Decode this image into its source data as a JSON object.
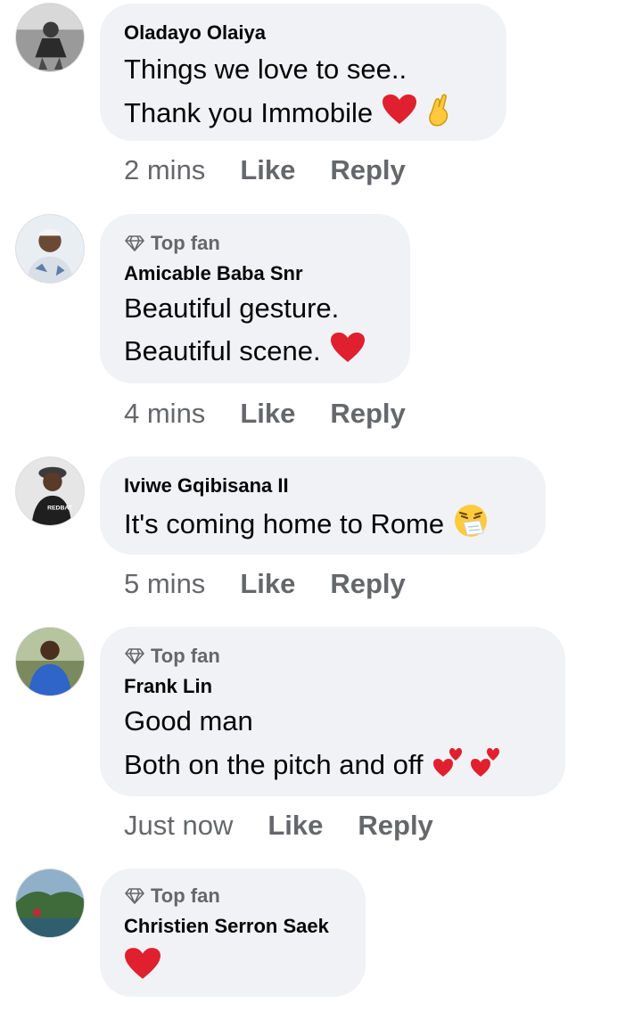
{
  "comments": [
    {
      "author": "Oladayo Olaiya",
      "top_fan": false,
      "lines": [
        "Things we love to see..",
        "Thank you Immobile"
      ],
      "emojis": [
        "red-heart",
        "crossed-fingers"
      ],
      "time": "2 mins",
      "like": "Like",
      "reply": "Reply"
    },
    {
      "author": "Amicable Baba Snr",
      "top_fan": true,
      "badge": "Top fan",
      "lines": [
        "Beautiful gesture.",
        "Beautiful scene."
      ],
      "emojis": [
        "red-heart"
      ],
      "time": "4 mins",
      "like": "Like",
      "reply": "Reply"
    },
    {
      "author": "Iviwe Gqibisana II",
      "top_fan": false,
      "lines": [
        "It's coming home to Rome"
      ],
      "emojis": [
        "sneezing-face"
      ],
      "time": "5 mins",
      "like": "Like",
      "reply": "Reply"
    },
    {
      "author": "Frank Lin",
      "top_fan": true,
      "badge": "Top fan",
      "lines": [
        "Good man",
        "Both on the pitch and off"
      ],
      "emojis": [
        "revolving-hearts",
        "revolving-hearts"
      ],
      "time": "Just now",
      "like": "Like",
      "reply": "Reply"
    },
    {
      "author": "Christien Serron Saek",
      "top_fan": true,
      "badge": "Top fan",
      "lines": [],
      "emojis": [
        "red-heart"
      ],
      "time": "",
      "like": "",
      "reply": ""
    }
  ],
  "colors": {
    "bubble": "#f0f2f5",
    "secondary_text": "#65676b",
    "primary_text": "#050505",
    "heart": "#e0202e"
  }
}
